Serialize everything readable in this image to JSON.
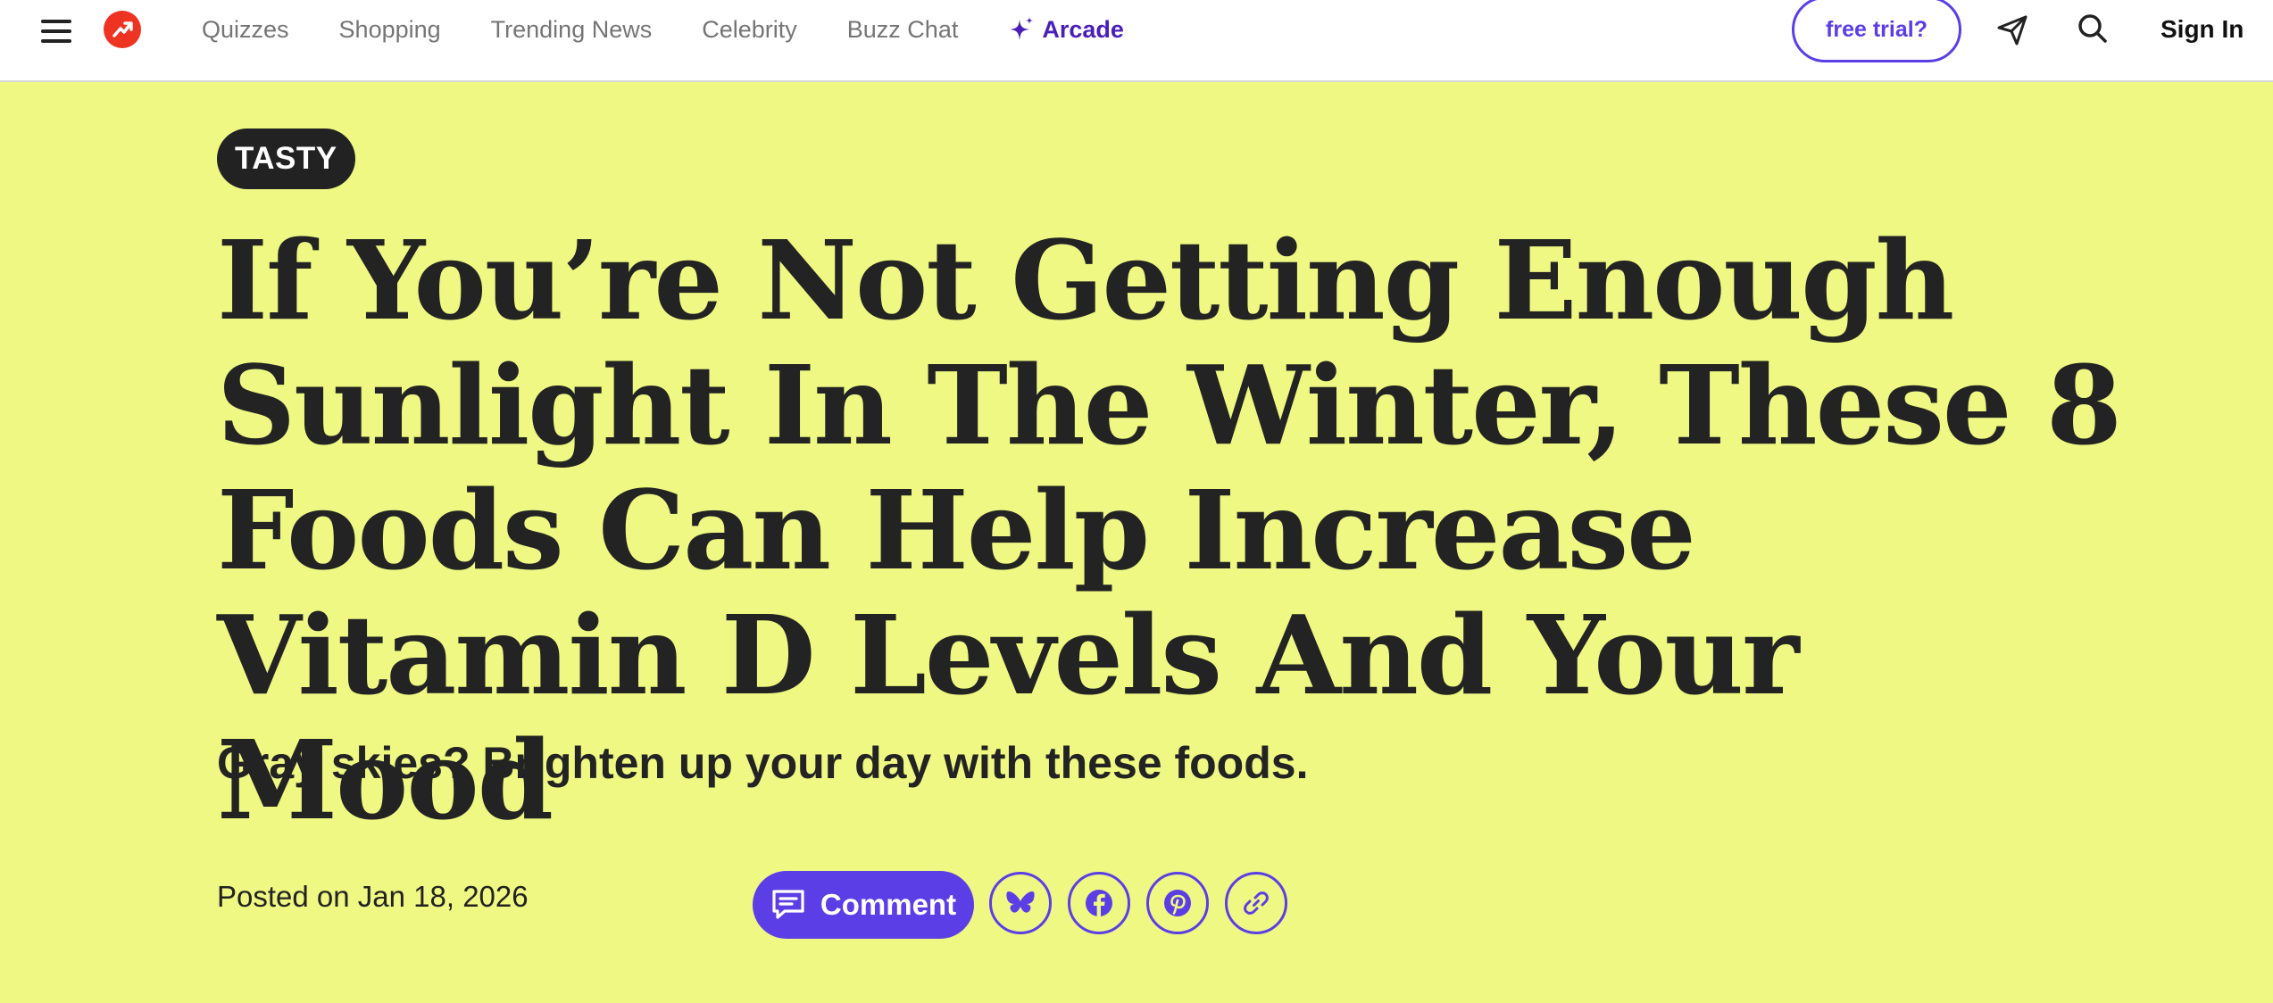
{
  "nav": {
    "items": [
      {
        "label": "Quizzes",
        "name": "nav-quizzes"
      },
      {
        "label": "Shopping",
        "name": "nav-shopping"
      },
      {
        "label": "Trending News",
        "name": "nav-trending-news"
      },
      {
        "label": "Celebrity",
        "name": "nav-celebrity"
      },
      {
        "label": "Buzz Chat",
        "name": "nav-buzz-chat"
      }
    ],
    "arcade_label": "Arcade",
    "trial_label": "free trial?",
    "signin_label": "Sign In",
    "icons": [
      "menu-icon",
      "trending-logo-icon",
      "sparkle-icon",
      "send-icon",
      "search-icon"
    ]
  },
  "article": {
    "tag": "TASTY",
    "headline": "If You’re Not Getting Enough Sunlight In The Winter, These 8 Foods Can Help Increase Vitamin D Levels And Your Mood",
    "subhead": "Gray skies? Brighten up your day with these foods.",
    "posted": "Posted on Jan 18, 2026",
    "comment_label": "Comment",
    "share_icons": [
      "bluesky-icon",
      "facebook-icon",
      "pinterest-icon",
      "link-icon"
    ]
  },
  "colors": {
    "background": "#eef882",
    "accent": "#5b3ee6",
    "logo": "#ee3322",
    "text": "#222222",
    "arcade": "#4a1fb8"
  }
}
